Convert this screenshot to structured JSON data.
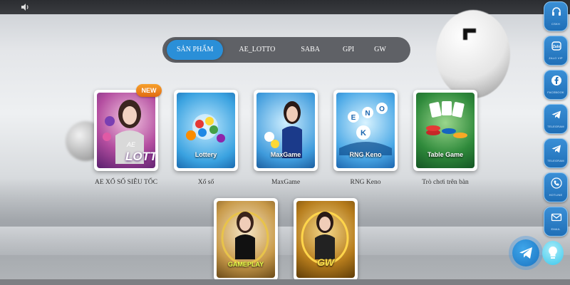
{
  "tabs": [
    {
      "label": "SẢN PHẨM",
      "active": true
    },
    {
      "label": "AE_LOTTO",
      "active": false
    },
    {
      "label": "SABA",
      "active": false
    },
    {
      "label": "GPI",
      "active": false
    },
    {
      "label": "GW",
      "active": false
    }
  ],
  "products": [
    {
      "label": "AE XỔ SỐ SIÊU TỐC",
      "badge": "NEW",
      "art_text": "LOTTO",
      "art_sub": "AE"
    },
    {
      "label": "Xổ số",
      "art_text": "Lottery"
    },
    {
      "label": "MaxGame",
      "art_text": "MaxGame"
    },
    {
      "label": "RNG Keno",
      "art_text": "RNG Keno"
    },
    {
      "label": "Trò chơi trên bàn",
      "art_text": "Table Game"
    },
    {
      "art_text": "GAMEPLAY"
    },
    {
      "art_text": "GW"
    }
  ],
  "sidebar": {
    "items": [
      {
        "label": "CSKH",
        "icon": "headset-icon"
      },
      {
        "label": "ZALO VIP",
        "icon": "zalo-icon"
      },
      {
        "label": "FACEBOOK",
        "icon": "facebook-icon"
      },
      {
        "label": "TELEGRAM",
        "icon": "telegram-icon"
      },
      {
        "label": "TELEGRAM",
        "icon": "telegram-icon"
      },
      {
        "label": "HOTLINE",
        "icon": "phone-icon"
      },
      {
        "label": "EMAIL",
        "icon": "mail-icon"
      }
    ]
  },
  "colors": {
    "active_tab": "#2a8fd8",
    "tab_bar": "#5f6166",
    "sidebar_blue": "#1f6fb7",
    "badge_orange": "#e06a12"
  }
}
